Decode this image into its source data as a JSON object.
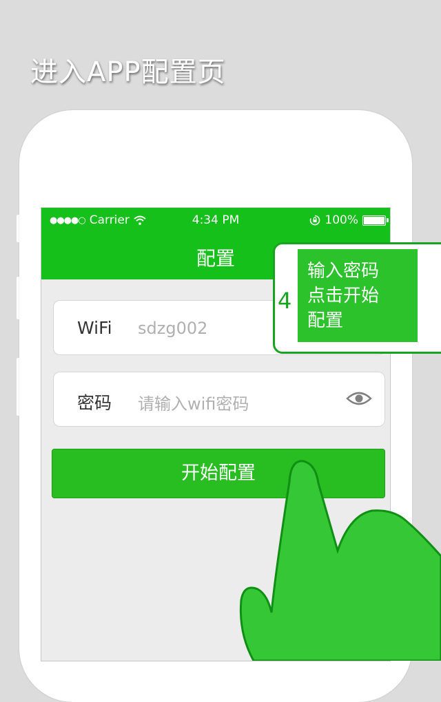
{
  "headline": "进入APP配置页",
  "status_bar": {
    "carrier": "Carrier",
    "time": "4:34 PM",
    "battery": "100%"
  },
  "nav": {
    "title": "配置"
  },
  "wifi_field": {
    "label": "WiFi",
    "value": "sdzg002"
  },
  "password_field": {
    "label": "密码",
    "placeholder": "请输入wifi密码"
  },
  "start_button": {
    "label": "开始配置"
  },
  "callout": {
    "step": "4",
    "lines": [
      "输入密码",
      "点击开始",
      "配置"
    ]
  },
  "colors": {
    "brand_green": "#15c01a",
    "button_green": "#28bd21",
    "hand_green": "#35c735"
  }
}
